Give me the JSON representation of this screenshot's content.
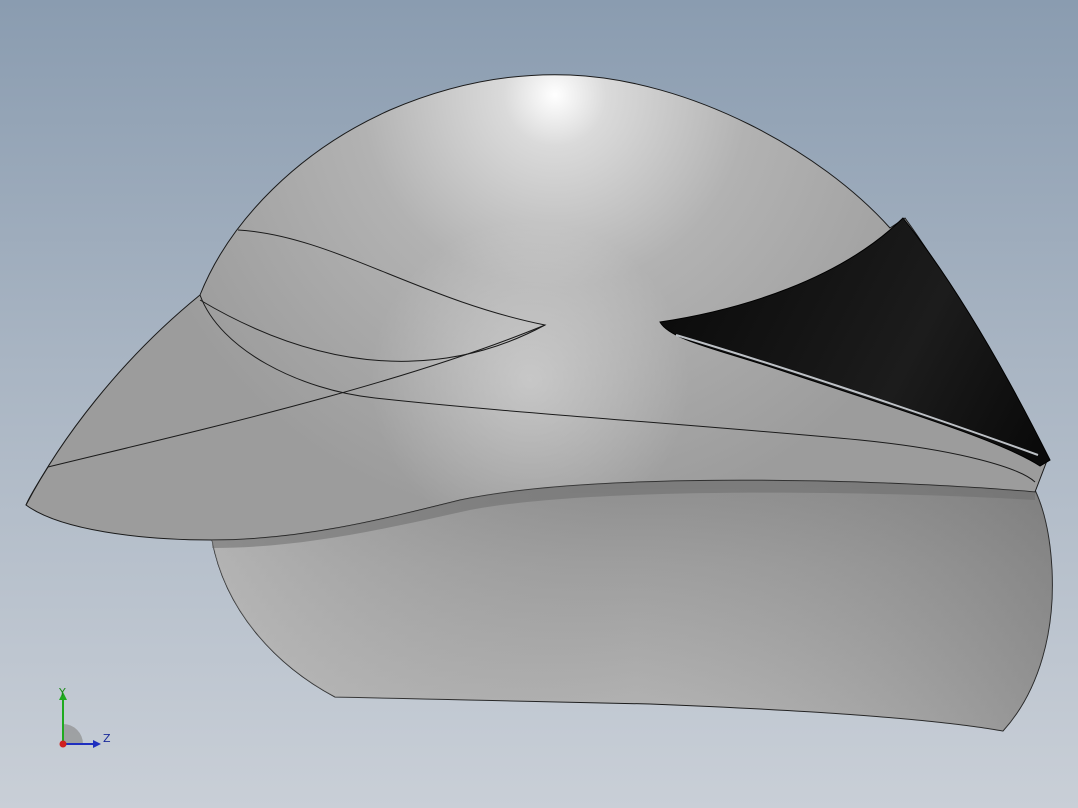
{
  "viewport": {
    "background_top": "#8a9cb0",
    "background_bottom": "#c9cfd7"
  },
  "model": {
    "name": "aero-helmet",
    "shell_color": "#b4b4b4",
    "shell_shadow_color": "#7a7a7a",
    "visor_color": "#111111",
    "edge_color": "#1a1a1a"
  },
  "triad": {
    "y_label": "Y",
    "z_label": "Z",
    "y_color": "#1faa1f",
    "z_color": "#1f2fbf",
    "x_color": "#d02020"
  }
}
